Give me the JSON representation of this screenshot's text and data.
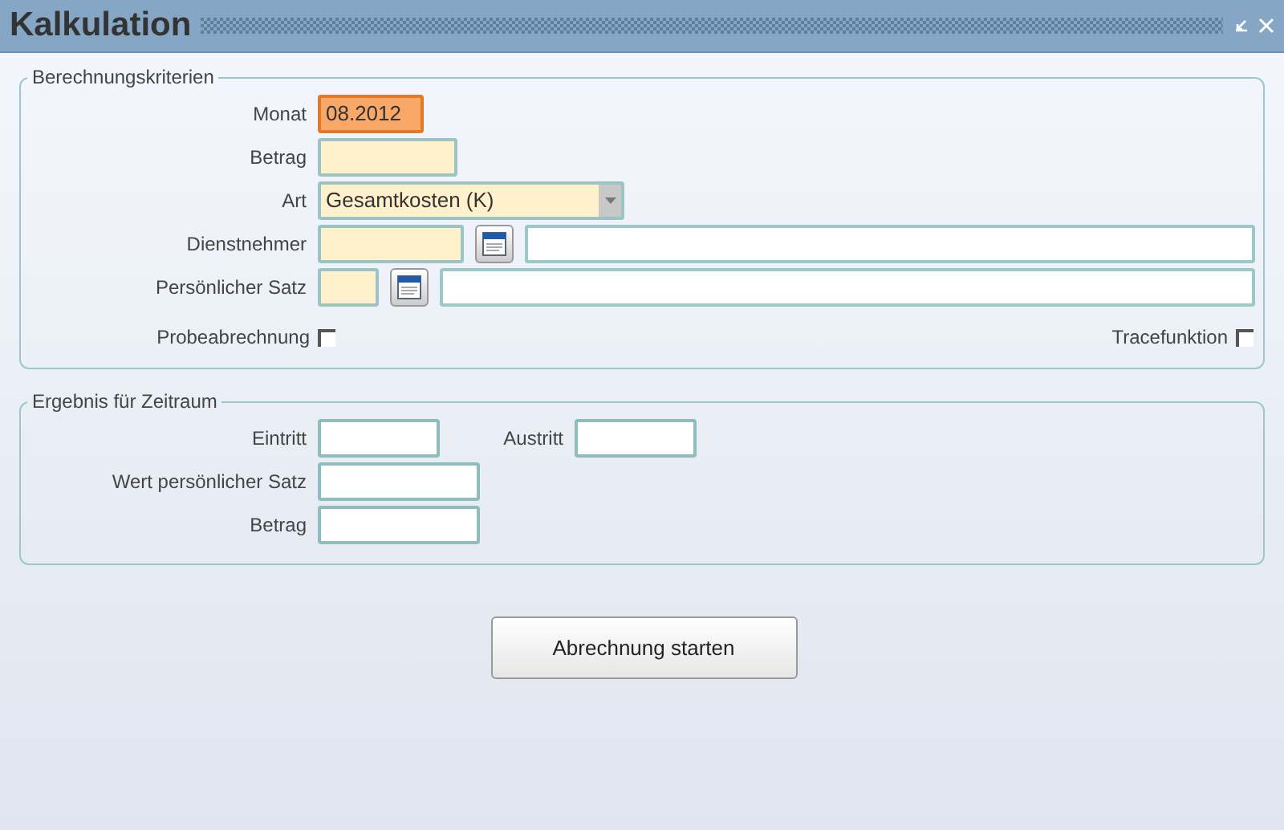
{
  "window": {
    "title": "Kalkulation"
  },
  "criteria": {
    "legend": "Berechnungskriterien",
    "fields": [
      {
        "label": "Monat",
        "kind": "text",
        "value": "08.2012",
        "focused": true
      },
      {
        "label": "Betrag",
        "kind": "text",
        "focused": false,
        "required": true
      },
      {
        "label": "Art",
        "kind": "select",
        "value": "Gesamtkosten (K)",
        "focused": false,
        "required": true
      },
      {
        "label": "Dienstnehmer",
        "kind": "lookup",
        "focused": false,
        "required": true
      },
      {
        "label": "Persönlicher Satz",
        "kind": "lookup",
        "focused": false,
        "required": true
      }
    ],
    "checkboxes": [
      {
        "label": "Probeabrechnung",
        "checked": false
      },
      {
        "label": "Tracefunktion",
        "checked": false
      }
    ]
  },
  "result": {
    "legend": "Ergebnis für Zeitraum",
    "rows": [
      [
        {
          "label": "Eintritt",
          "required": false
        },
        {
          "label": "Austritt",
          "required": false
        }
      ],
      [
        {
          "label": "Wert persönlicher Satz",
          "required": false
        }
      ],
      [
        {
          "label": "Betrag",
          "required": false
        }
      ]
    ]
  },
  "button": {
    "label": "Abrechnung starten"
  }
}
